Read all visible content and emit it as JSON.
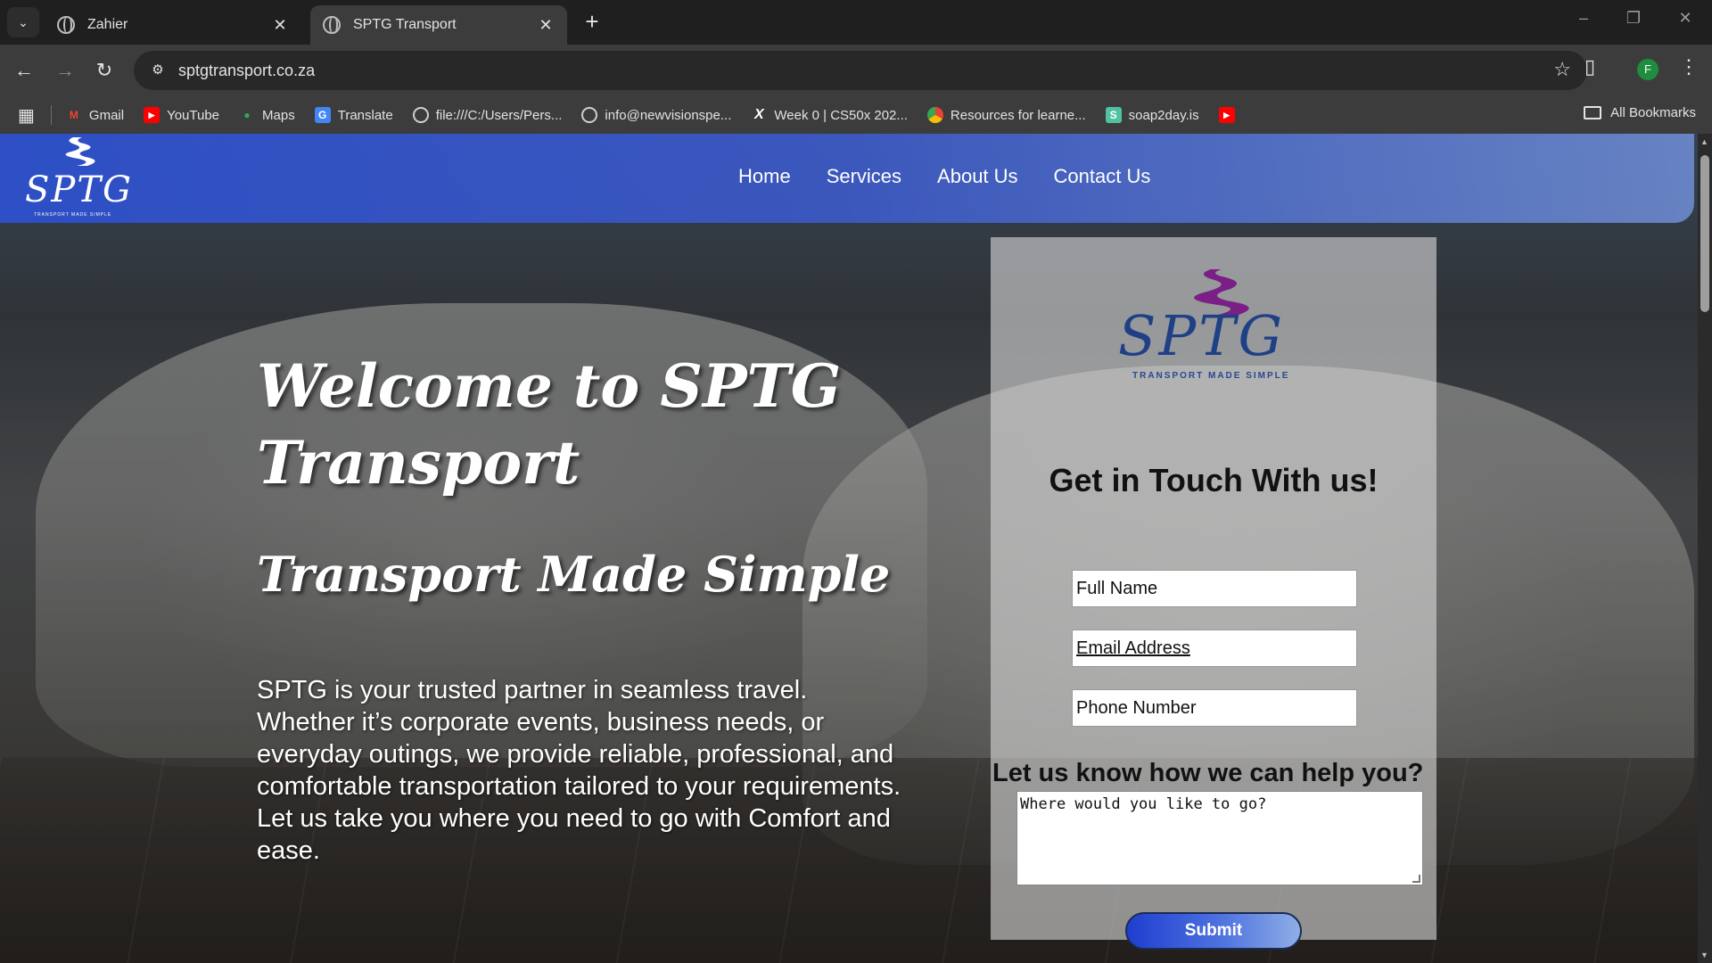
{
  "browser": {
    "tabs": [
      {
        "title": "Zahier",
        "active": false
      },
      {
        "title": "SPTG Transport",
        "active": true
      }
    ],
    "url": "sptgtransport.co.za",
    "profile_initial": "F",
    "bookmarks": [
      {
        "label": "Gmail",
        "icon": "gmail-icon"
      },
      {
        "label": "YouTube",
        "icon": "youtube-icon"
      },
      {
        "label": "Maps",
        "icon": "maps-icon"
      },
      {
        "label": "Translate",
        "icon": "translate-icon"
      },
      {
        "label": "file:///C:/Users/Pers...",
        "icon": "globe-icon"
      },
      {
        "label": "info@newvisionspe...",
        "icon": "globe-icon"
      },
      {
        "label": "Week 0 | CS50x 202...",
        "icon": "x-icon"
      },
      {
        "label": "Resources for learne...",
        "icon": "chrome-icon"
      },
      {
        "label": "soap2day.is",
        "icon": "s-icon"
      },
      {
        "label": "",
        "icon": "youtube-icon"
      }
    ],
    "all_bookmarks": "All Bookmarks"
  },
  "site": {
    "logo_text": "SPTG",
    "logo_tagline": "TRANSPORT MADE SIMPLE",
    "nav": [
      "Home",
      "Services",
      "About Us",
      "Contact Us"
    ],
    "colors": {
      "header": "#3656cf",
      "accent": "#2a4791",
      "logo_mark": "#7b1e86"
    }
  },
  "hero": {
    "title": "Welcome to SPTG Transport",
    "subtitle": "Transport Made Simple",
    "body": "SPTG is your trusted partner in seamless travel. Whether it’s corporate events, business needs, or everyday outings, we provide reliable, professional, and comfortable transportation tailored to your requirements. Let us take you where you need to go with Comfort and ease."
  },
  "contact": {
    "logo_text": "SPTG",
    "logo_tagline": "TRANSPORT MADE SIMPLE",
    "title": "Get in Touch With us!",
    "full_name": "Full Name",
    "email": "Email Address",
    "phone": "Phone Number",
    "help_label": "Let us know how we can help you?",
    "message_placeholder": "Where would you like to go?",
    "submit": "Submit"
  }
}
